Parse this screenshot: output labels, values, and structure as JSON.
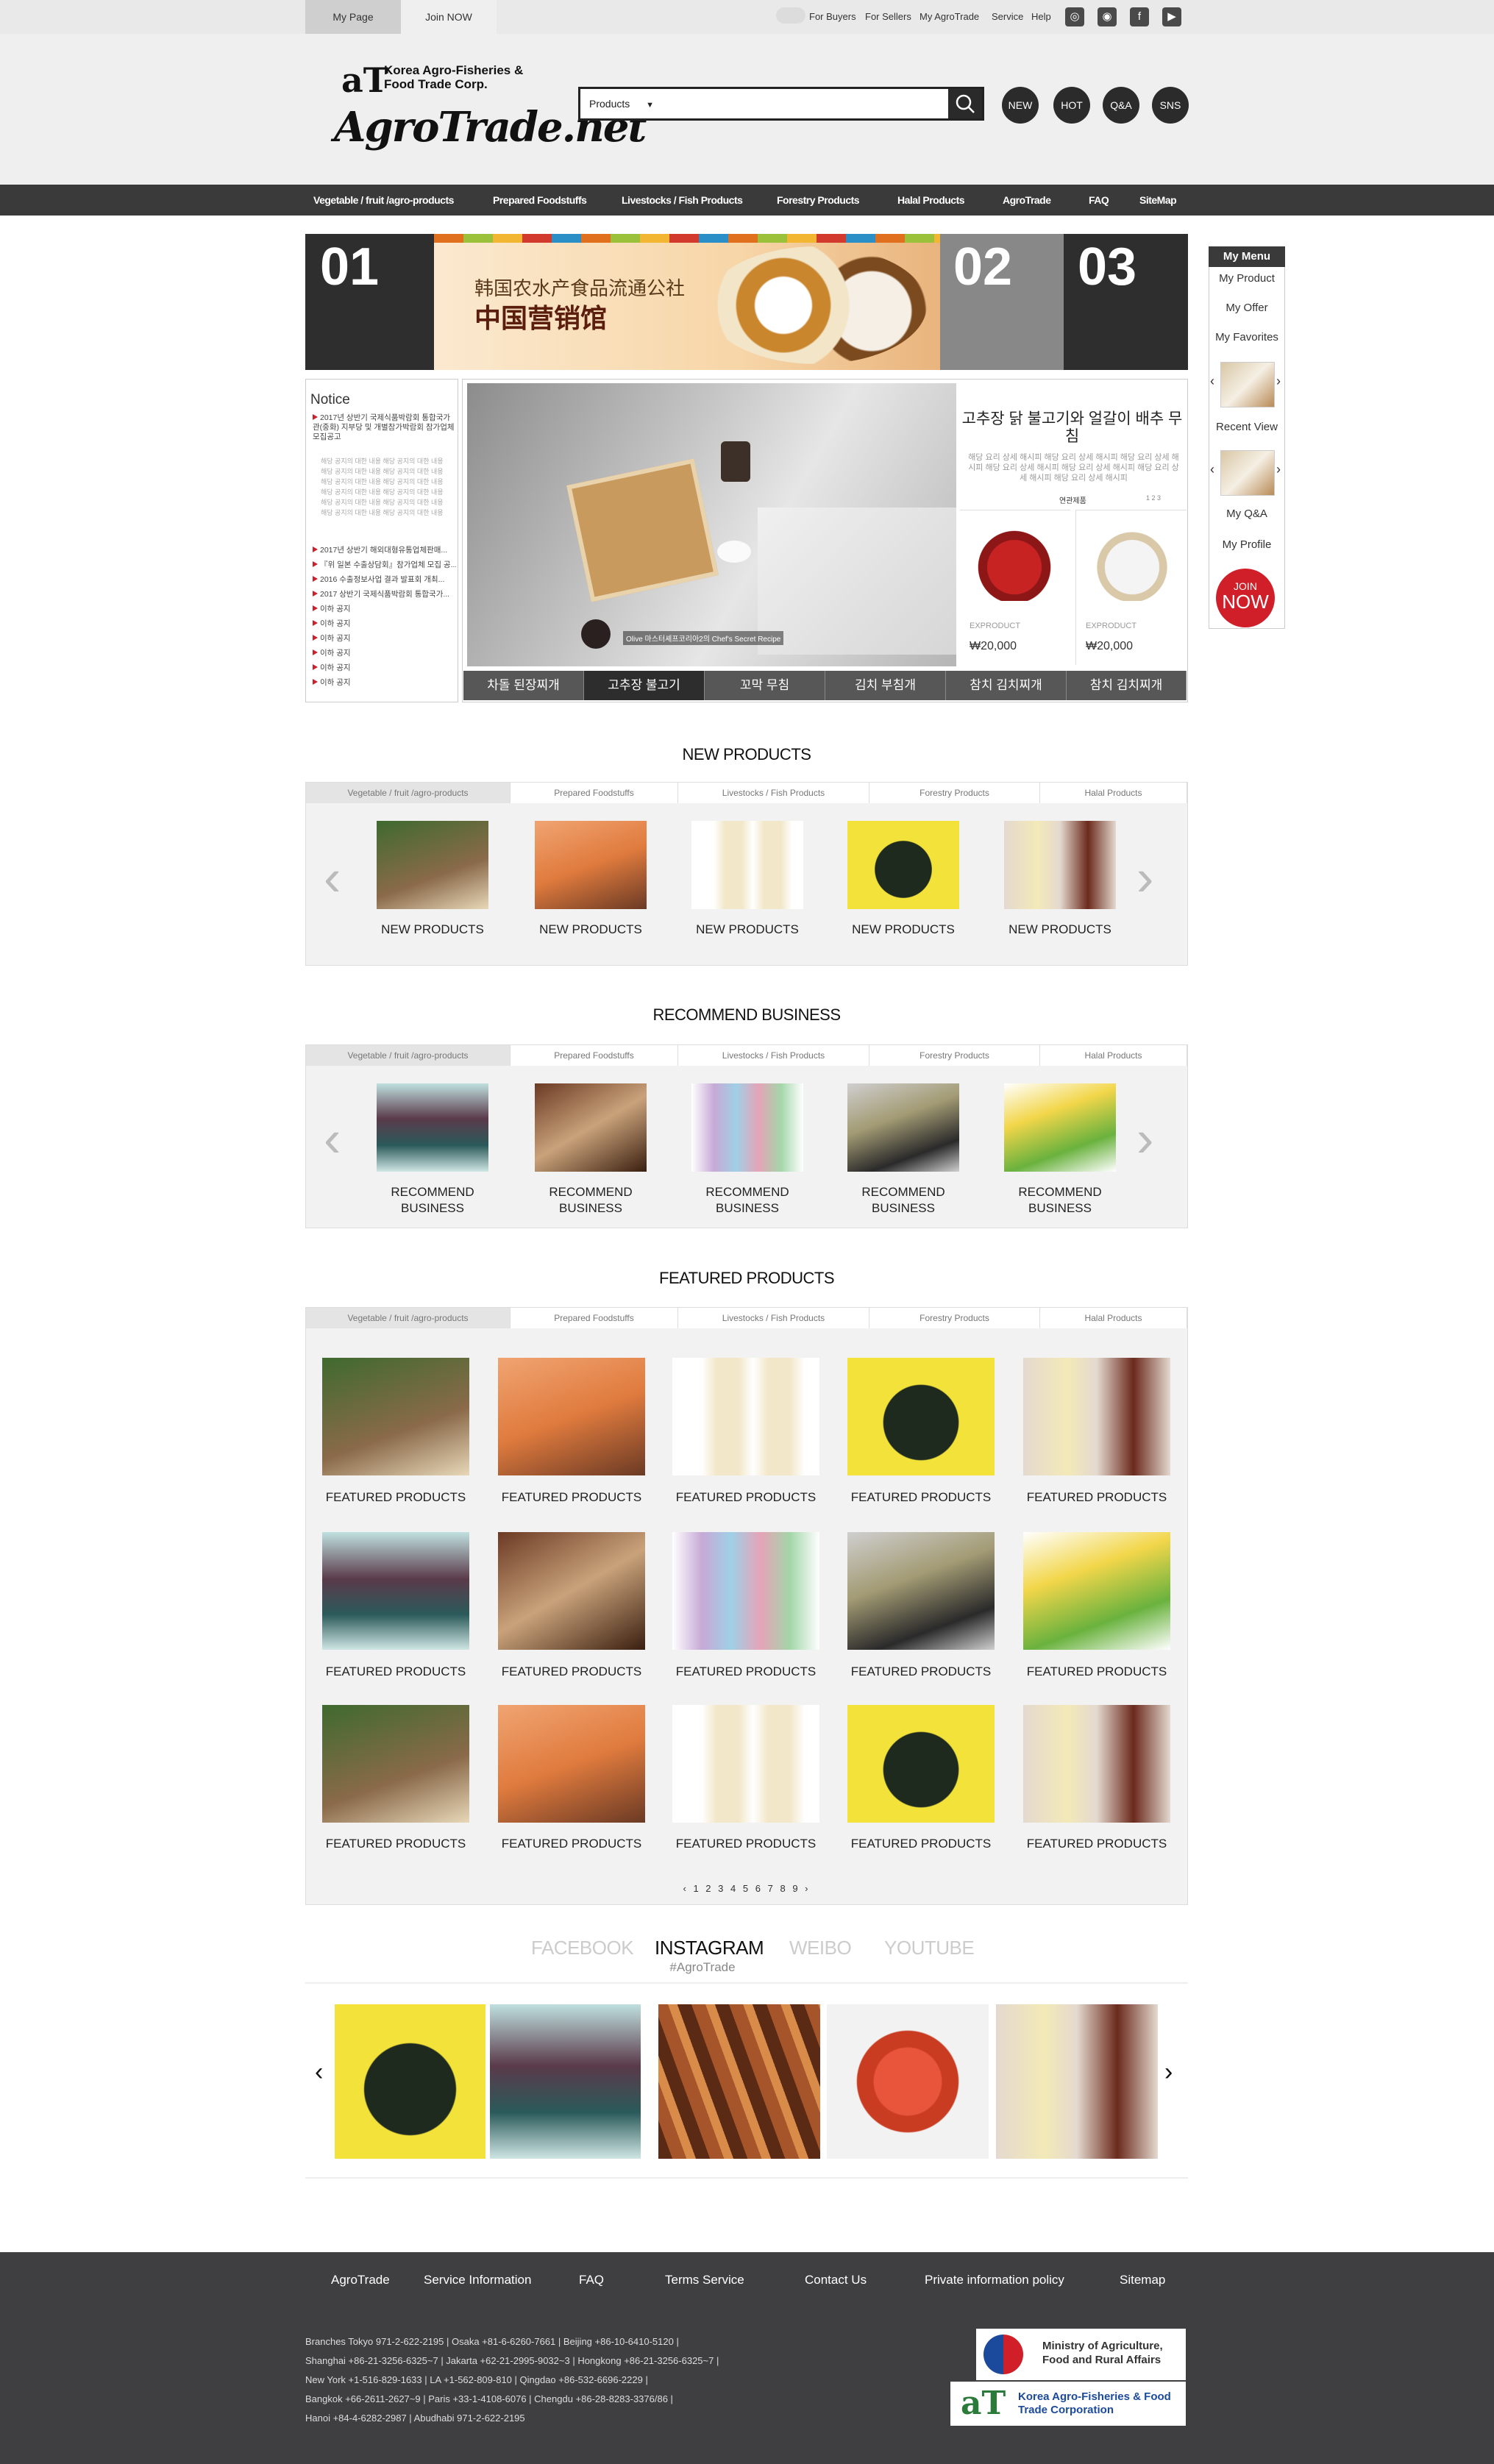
{
  "topbar": {
    "tabs": [
      "My Page",
      "Join NOW"
    ],
    "links": [
      "For Buyers",
      "For Sellers",
      "My AgroTrade",
      "Service",
      "Help"
    ],
    "social_icons": [
      "instagram-icon",
      "weibo-icon",
      "facebook-icon",
      "youtube-icon"
    ]
  },
  "header": {
    "logo_at": "aT",
    "logo_corp": "Korea Agro-Fisheries & Food Trade Corp.",
    "logo_main": "AgroTrade.net",
    "search_category": "Products",
    "search_placeholder": "",
    "circles": [
      "NEW",
      "HOT",
      "Q&A",
      "SNS"
    ]
  },
  "nav": [
    "Vegetable / fruit /agro-products",
    "Prepared Foodstuffs",
    "Livestocks / Fish Products",
    "Forestry Products",
    "Halal Products",
    "AgroTrade",
    "FAQ",
    "SiteMap"
  ],
  "banner": {
    "nums": [
      "01",
      "02",
      "03"
    ],
    "line1": "韩国农水产食品流通公社",
    "line2": "中国营销馆"
  },
  "mymenu": {
    "title": "My Menu",
    "items": [
      "My Product",
      "My Offer",
      "My Favorites"
    ],
    "recent": "Recent View",
    "items2": [
      "My Q&A",
      "My Profile"
    ],
    "join": [
      "JOIN",
      "NOW"
    ]
  },
  "notice": {
    "title": "Notice",
    "first": "2017년 상반기 국제식품박람회 통합국가관(중화) 지부당 및 개별참가박람회 참가업체 모집공고",
    "sub": [
      "해당 공지의 대한 내용 해당 공지의 대한 내용",
      "해당 공지의 대한 내용 해당 공지의 대한 내용",
      "해당 공지의 대한 내용 해당 공지의 대한 내용",
      "해당 공지의 대한 내용 해당 공지의 대한 내용",
      "해당 공지의 대한 내용 해당 공지의 대한 내용",
      "해당 공지의 대한 내용 해당 공지의 대한 내용"
    ],
    "items": [
      "2017년 상반기 해외대형유통업체판매...",
      "『위 일본 수출상담회』참가업체 모집 공...",
      "2016 수출정보사업 결과 발표회 개최...",
      "2017 상반기 국제식품박람회 통합국가...",
      "이하 공지",
      "이하 공지",
      "이하 공지",
      "이하 공지",
      "이하 공지",
      "이하 공지"
    ]
  },
  "hero": {
    "title": "고추장 닭 불고기와 얼갈이 배추 무침",
    "desc": "해당 요리 상세 해시피 해당 요리 상세 해시피 해당 요리 상세 해시피 해당 요리 상세 해시피 해당 요리 상세 해시피 해당 요리 상세 해시피 해당 요리 상세 해시피",
    "caption": "Olive 마스터셰프코리아2의 Chef's Secret Recipe",
    "related_label": "연관제품",
    "related_pages": "1 2 3",
    "products": [
      {
        "label": "EXPRODUCT",
        "price": "₩20,000"
      },
      {
        "label": "EXPRODUCT",
        "price": "₩20,000"
      }
    ],
    "tabs": [
      "차돌 된장찌개",
      "고추장 불고기",
      "꼬막 무침",
      "김치 부침개",
      "참치 김치찌개",
      "참치 김치찌개"
    ]
  },
  "categories": [
    "Vegetable / fruit /agro-products",
    "Prepared Foodstuffs",
    "Livestocks / Fish Products",
    "Forestry Products",
    "Halal Products"
  ],
  "new_products": {
    "title": "NEW PRODUCTS",
    "items": [
      "NEW PRODUCTS",
      "NEW PRODUCTS",
      "NEW PRODUCTS",
      "NEW PRODUCTS",
      "NEW PRODUCTS"
    ]
  },
  "recommend": {
    "title": "RECOMMEND BUSINESS",
    "items": [
      "RECOMMEND BUSINESS",
      "RECOMMEND BUSINESS",
      "RECOMMEND BUSINESS",
      "RECOMMEND BUSINESS",
      "RECOMMEND BUSINESS"
    ]
  },
  "featured": {
    "title": "FEATURED PRODUCTS",
    "item_label": "FEATURED PRODUCTS",
    "pager": [
      "‹",
      "1",
      "2",
      "3",
      "4",
      "5",
      "6",
      "7",
      "8",
      "9",
      "›"
    ]
  },
  "social": {
    "tabs": [
      "FACEBOOK",
      "INSTAGRAM",
      "WEIBO",
      "YOUTUBE"
    ],
    "active": "INSTAGRAM",
    "hashtag": "#AgroTrade"
  },
  "footer": {
    "nav": [
      "AgroTrade",
      "Service Information",
      "FAQ",
      "Terms Service",
      "Contact Us",
      "Private information policy",
      "Sitemap"
    ],
    "addresses": [
      "Branches Tokyo 971-2-622-2195  |  Osaka +81-6-6260-7661  |  Beijing +86-10-6410-5120  |",
      "Shanghai +86-21-3256-6325~7  |  Jakarta +62-21-2995-9032~3  |  Hongkong +86-21-3256-6325~7  |",
      "New York +1-516-829-1633  |  LA +1-562-809-810  |  Qingdao +86-532-6696-2229  |",
      "Bangkok +66-2611-2627~9  |  Paris +33-1-4108-6076  |  Chengdu +86-28-8283-3376/86  |",
      "Hanoi +84-4-6282-2987  |  Abudhabi 971-2-622-2195"
    ],
    "ministry": "Ministry of Agriculture, Food and Rural Affairs",
    "at_logo": "aT",
    "at_corp": "Korea Agro-Fisheries & Food Trade Corporation"
  },
  "colors": {
    "dark": "#3a3a3a",
    "accent_red": "#d11f2a",
    "light_bg": "#efefef"
  }
}
